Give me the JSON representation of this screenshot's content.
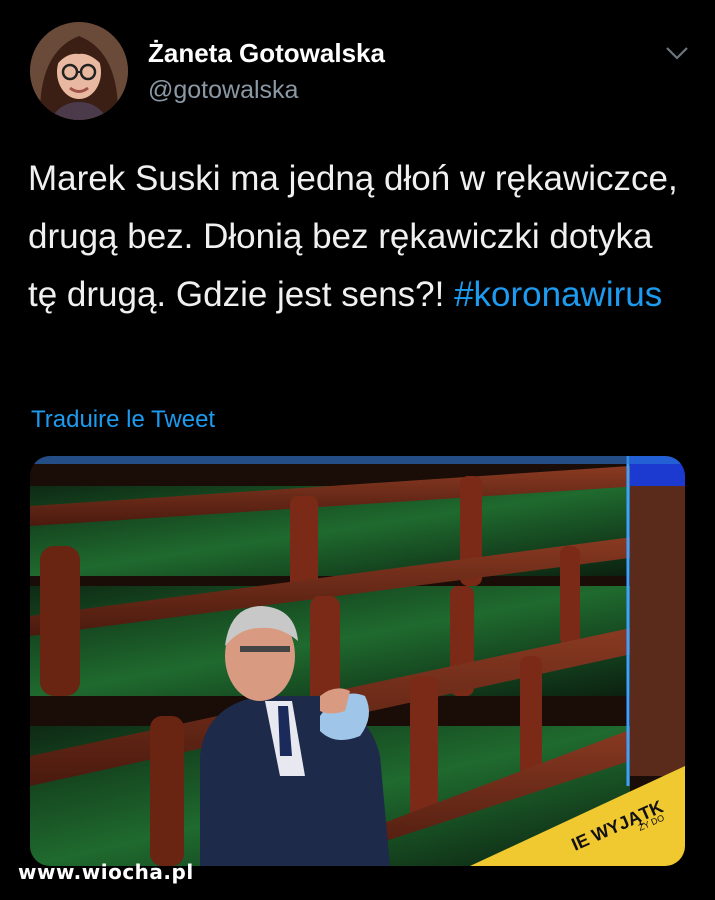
{
  "author": {
    "display_name": "Żaneta Gotowalska",
    "handle": "@gotowalska",
    "avatar_icon": "profile-photo"
  },
  "tweet": {
    "text": "Marek Suski ma jedną dłoń w rękawiczce, drugą bez. Dłonią bez rękawiczki dotyka tę drugą. Gdzie jest sens?!",
    "hashtag": "#koronawirus",
    "translate_label": "Traduire le Tweet"
  },
  "media": {
    "description_icon": "photo-parliament-benches",
    "banner_text": "IE WYJĄTK",
    "banner_subtext": "ZY DO"
  },
  "watermark": "www.wiocha.pl",
  "colors": {
    "background": "#000000",
    "link": "#1d9bf0",
    "secondary_text": "#8b98a5"
  }
}
